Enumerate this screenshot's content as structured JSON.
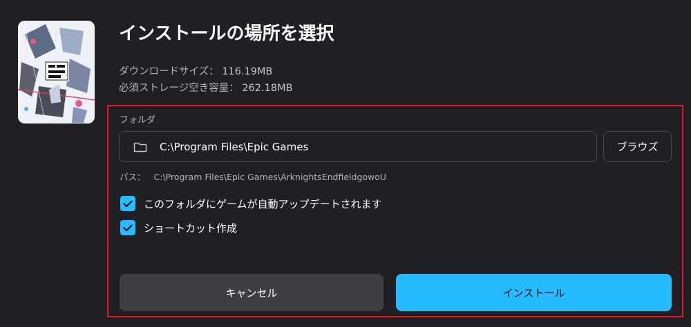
{
  "dialog": {
    "title": "インストールの場所を選択",
    "download_size_label": "ダウンロードサイズ：",
    "download_size_value": "116.19MB",
    "storage_label": "必須ストレージ空き容量：",
    "storage_value": "262.18MB"
  },
  "cover": {
    "alt_icon": "game-cover-art"
  },
  "folder": {
    "label": "フォルダ",
    "value": "C:\\Program Files\\Epic Games",
    "browse_label": "ブラウズ",
    "path_label": "パス：",
    "path_value": "C:\\Program Files\\Epic Games\\ArknightsEndfieldgowoU"
  },
  "options": {
    "auto_update_label": "このフォルダにゲームが自動アップデートされます",
    "auto_update_checked": true,
    "shortcut_label": "ショートカット作成",
    "shortcut_checked": true
  },
  "buttons": {
    "cancel_label": "キャンセル",
    "install_label": "インストール"
  },
  "colors": {
    "background": "#202024",
    "accent": "#26bbff",
    "highlight_border": "#e3192b",
    "secondary_button": "#3e3e44"
  }
}
